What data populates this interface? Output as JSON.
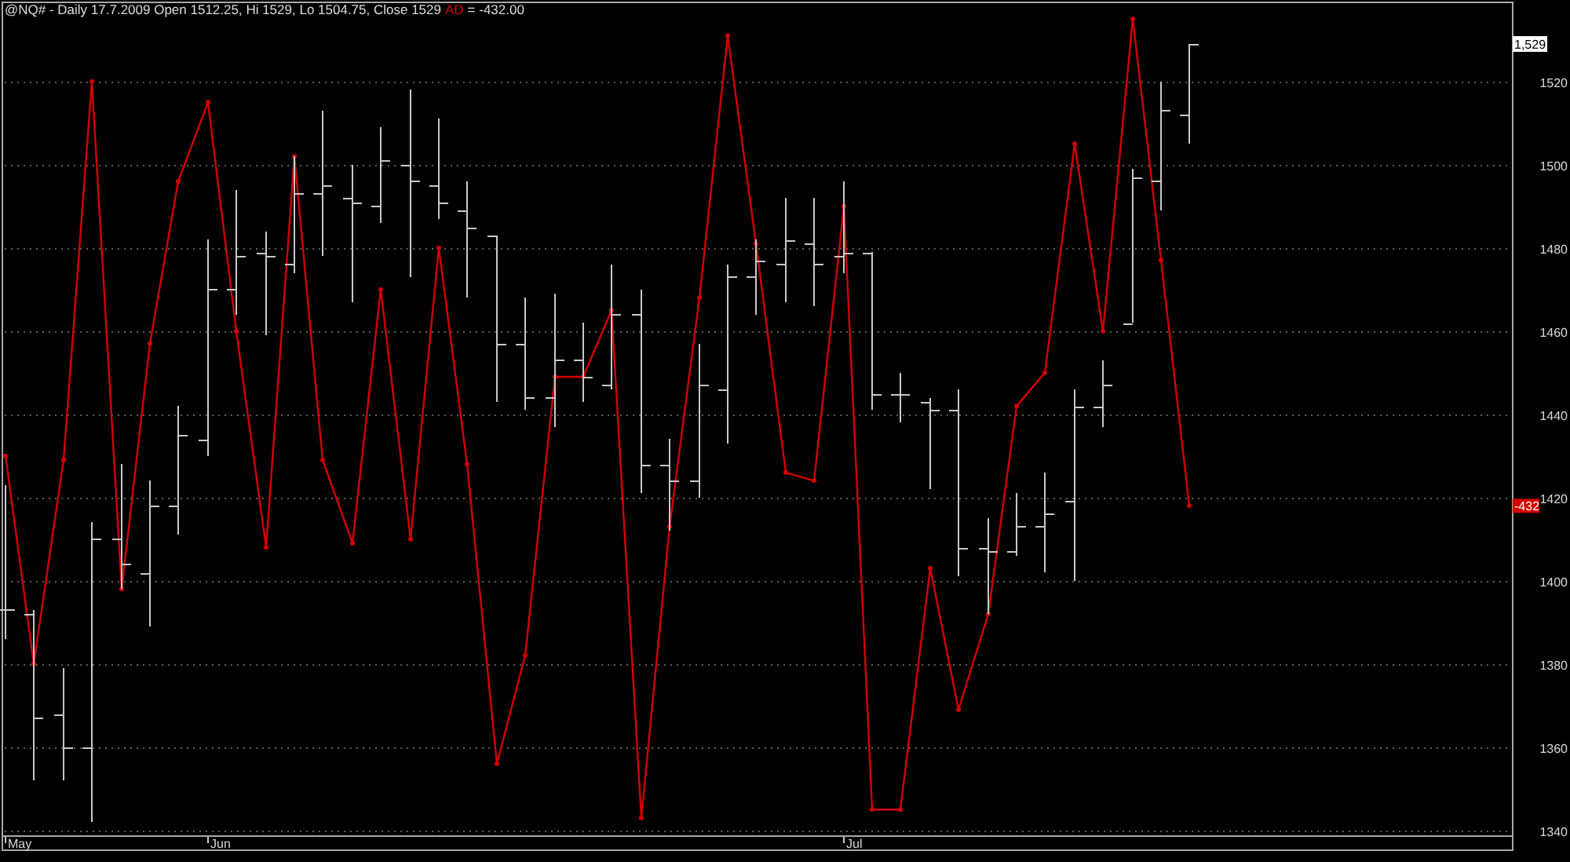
{
  "chart": {
    "header": {
      "title": "@NQ# - Daily 17.7.2009 Open 1512.25, Hi 1529, Lo 1504.75, Close 1529",
      "indicator_reading": "= -432.00"
    },
    "markers": {
      "last_price": "1,529",
      "indicator_value": "-432"
    },
    "chart_data": {
      "type": "line",
      "grid": true,
      "categories": [
        "May",
        null,
        null,
        null,
        null,
        null,
        null,
        "Jun",
        null,
        null,
        null,
        null,
        null,
        null,
        null,
        null,
        null,
        null,
        null,
        null,
        null,
        null,
        null,
        null,
        null,
        null,
        null,
        null,
        null,
        "Jul",
        null,
        null,
        null,
        null,
        null,
        null,
        null,
        null,
        null,
        null,
        null,
        null
      ],
      "ylim": [
        1338.8,
        1539.2
      ],
      "yticks": [
        1340,
        1360,
        1380,
        1400,
        1420,
        1440,
        1460,
        1480,
        1500,
        1520
      ],
      "series": [
        {
          "name": "AD",
          "color": "#d40000",
          "values": [
            1430,
            1380,
            1429,
            1520,
            1398,
            1457,
            1496,
            1515,
            1460,
            1408,
            1502,
            1429,
            1409,
            1470,
            1410,
            1480,
            1428,
            1356,
            1382,
            1449,
            1449,
            1465,
            1343,
            1413,
            1468,
            1531,
            1481,
            1426,
            1424,
            1490,
            1345,
            1345,
            1403,
            1369,
            1392,
            1442,
            1450,
            1505,
            1460,
            1535,
            1477,
            1418
          ]
        }
      ]
    }
  }
}
